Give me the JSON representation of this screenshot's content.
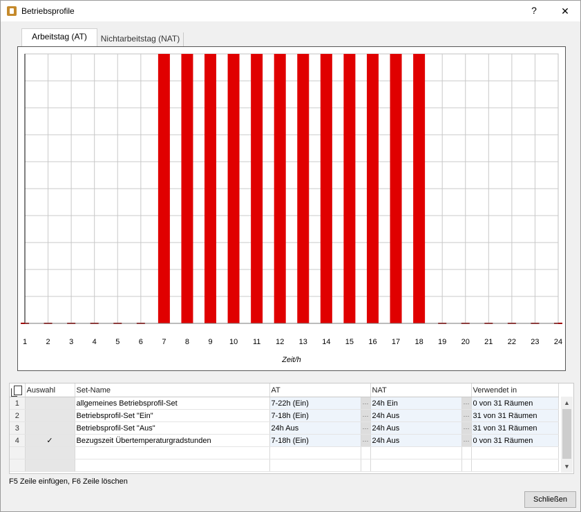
{
  "window": {
    "title": "Betriebsprofile",
    "help_label": "?",
    "close_label": "✕"
  },
  "tabs": [
    {
      "label": "Arbeitstag (AT)",
      "active": true
    },
    {
      "label": "Nichtarbeitstag (NAT)",
      "active": false
    }
  ],
  "chart_data": {
    "type": "bar",
    "xlabel": "Zeit/h",
    "categories": [
      "1",
      "2",
      "3",
      "4",
      "5",
      "6",
      "7",
      "8",
      "9",
      "10",
      "11",
      "12",
      "13",
      "14",
      "15",
      "16",
      "17",
      "18",
      "19",
      "20",
      "21",
      "22",
      "23",
      "24"
    ],
    "values": [
      0,
      0,
      0,
      0,
      0,
      0,
      1,
      1,
      1,
      1,
      1,
      1,
      1,
      1,
      1,
      1,
      1,
      1,
      0,
      0,
      0,
      0,
      0,
      0
    ],
    "ylim": [
      0,
      1
    ],
    "bar_color": "#e00000",
    "grid": true
  },
  "table": {
    "columns": [
      "Auswahl",
      "Set-Name",
      "AT",
      "NAT",
      "Verwendet in"
    ],
    "rows": [
      {
        "num": "1",
        "auswahl": "",
        "name": "allgemeines Betriebsprofil-Set",
        "at": "7-22h (Ein)",
        "nat": "24h Ein",
        "used": "0 von 31 Räumen"
      },
      {
        "num": "2",
        "auswahl": "",
        "name": "Betriebsprofil-Set \"Ein\"",
        "at": "7-18h (Ein)",
        "nat": "24h Aus",
        "used": "31 von 31 Räumen"
      },
      {
        "num": "3",
        "auswahl": "",
        "name": "Betriebsprofil-Set \"Aus\"",
        "at": "24h Aus",
        "nat": "24h Aus",
        "used": "31 von 31 Räumen"
      },
      {
        "num": "4",
        "auswahl": "✓",
        "name": "Bezugszeit Übertemperaturgradstunden",
        "at": "7-18h (Ein)",
        "nat": "24h Aus",
        "used": "0 von 31 Räumen"
      }
    ],
    "copy_icon": "copy-icon",
    "dots": "···",
    "scroll_up": "▲",
    "scroll_down": "▼"
  },
  "footer": {
    "hint": "F5 Zeile einfügen, F6 Zeile löschen",
    "close_button": "Schließen"
  }
}
